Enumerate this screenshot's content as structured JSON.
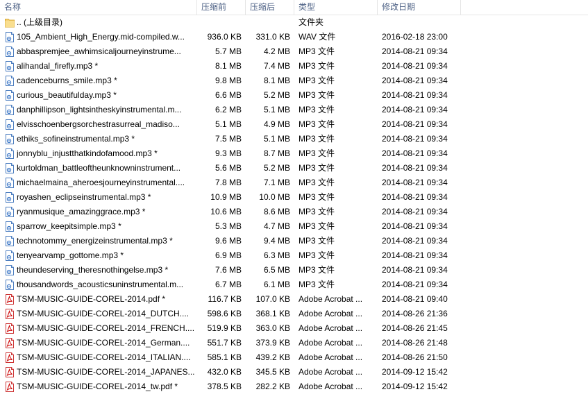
{
  "header": {
    "name": "名称",
    "compressed": "压缩前",
    "size": "压缩后",
    "type": "类型",
    "modified": "修改日期"
  },
  "rows": [
    {
      "icon": "folder-icon",
      "name": ".. (上级目录)",
      "compressed": "",
      "size": "",
      "type": "文件夹",
      "modified": ""
    },
    {
      "icon": "audio-file-icon",
      "name": "105_Ambient_High_Energy.mid-compiled.w...",
      "compressed": "936.0 KB",
      "size": "331.0 KB",
      "type": "WAV 文件",
      "modified": "2016-02-18 23:00"
    },
    {
      "icon": "audio-file-icon",
      "name": "abbaspremjee_awhimsicaljourneyinstrume...",
      "compressed": "5.7 MB",
      "size": "4.2 MB",
      "type": "MP3 文件",
      "modified": "2014-08-21 09:34"
    },
    {
      "icon": "audio-file-icon",
      "name": "alihandal_firefly.mp3 *",
      "compressed": "8.1 MB",
      "size": "7.4 MB",
      "type": "MP3 文件",
      "modified": "2014-08-21 09:34"
    },
    {
      "icon": "audio-file-icon",
      "name": "cadenceburns_smile.mp3 *",
      "compressed": "9.8 MB",
      "size": "8.1 MB",
      "type": "MP3 文件",
      "modified": "2014-08-21 09:34"
    },
    {
      "icon": "audio-file-icon",
      "name": "curious_beautifulday.mp3 *",
      "compressed": "6.6 MB",
      "size": "5.2 MB",
      "type": "MP3 文件",
      "modified": "2014-08-21 09:34"
    },
    {
      "icon": "audio-file-icon",
      "name": "danphillipson_lightsintheskyinstrumental.m...",
      "compressed": "6.2 MB",
      "size": "5.1 MB",
      "type": "MP3 文件",
      "modified": "2014-08-21 09:34"
    },
    {
      "icon": "audio-file-icon",
      "name": "elvisschoenbergsorchestrasurreal_madiso...",
      "compressed": "5.1 MB",
      "size": "4.9 MB",
      "type": "MP3 文件",
      "modified": "2014-08-21 09:34"
    },
    {
      "icon": "audio-file-icon",
      "name": "ethiks_sofineinstrumental.mp3 *",
      "compressed": "7.5 MB",
      "size": "5.1 MB",
      "type": "MP3 文件",
      "modified": "2014-08-21 09:34"
    },
    {
      "icon": "audio-file-icon",
      "name": "jonnyblu_injustthatkindofamood.mp3 *",
      "compressed": "9.3 MB",
      "size": "8.7 MB",
      "type": "MP3 文件",
      "modified": "2014-08-21 09:34"
    },
    {
      "icon": "audio-file-icon",
      "name": "kurtoldman_battleoftheunknowninstrument...",
      "compressed": "5.6 MB",
      "size": "5.2 MB",
      "type": "MP3 文件",
      "modified": "2014-08-21 09:34"
    },
    {
      "icon": "audio-file-icon",
      "name": "michaelmaina_aheroesjourneyinstrumental....",
      "compressed": "7.8 MB",
      "size": "7.1 MB",
      "type": "MP3 文件",
      "modified": "2014-08-21 09:34"
    },
    {
      "icon": "audio-file-icon",
      "name": "royashen_eclipseinstrumental.mp3 *",
      "compressed": "10.9 MB",
      "size": "10.0 MB",
      "type": "MP3 文件",
      "modified": "2014-08-21 09:34"
    },
    {
      "icon": "audio-file-icon",
      "name": "ryanmusique_amazinggrace.mp3 *",
      "compressed": "10.6 MB",
      "size": "8.6 MB",
      "type": "MP3 文件",
      "modified": "2014-08-21 09:34"
    },
    {
      "icon": "audio-file-icon",
      "name": "sparrow_keepitsimple.mp3 *",
      "compressed": "5.3 MB",
      "size": "4.7 MB",
      "type": "MP3 文件",
      "modified": "2014-08-21 09:34"
    },
    {
      "icon": "audio-file-icon",
      "name": "technotommy_energizeinstrumental.mp3 *",
      "compressed": "9.6 MB",
      "size": "9.4 MB",
      "type": "MP3 文件",
      "modified": "2014-08-21 09:34"
    },
    {
      "icon": "audio-file-icon",
      "name": "tenyearvamp_gottome.mp3 *",
      "compressed": "6.9 MB",
      "size": "6.3 MB",
      "type": "MP3 文件",
      "modified": "2014-08-21 09:34"
    },
    {
      "icon": "audio-file-icon",
      "name": "theundeserving_theresnothingelse.mp3 *",
      "compressed": "7.6 MB",
      "size": "6.5 MB",
      "type": "MP3 文件",
      "modified": "2014-08-21 09:34"
    },
    {
      "icon": "audio-file-icon",
      "name": "thousandwords_acousticsuninstrumental.m...",
      "compressed": "6.7 MB",
      "size": "6.1 MB",
      "type": "MP3 文件",
      "modified": "2014-08-21 09:34"
    },
    {
      "icon": "pdf-file-icon",
      "name": "TSM-MUSIC-GUIDE-COREL-2014.pdf *",
      "compressed": "116.7 KB",
      "size": "107.0 KB",
      "type": "Adobe Acrobat ...",
      "modified": "2014-08-21 09:40"
    },
    {
      "icon": "pdf-file-icon",
      "name": "TSM-MUSIC-GUIDE-COREL-2014_DUTCH....",
      "compressed": "598.6 KB",
      "size": "368.1 KB",
      "type": "Adobe Acrobat ...",
      "modified": "2014-08-26 21:36"
    },
    {
      "icon": "pdf-file-icon",
      "name": "TSM-MUSIC-GUIDE-COREL-2014_FRENCH....",
      "compressed": "519.9 KB",
      "size": "363.0 KB",
      "type": "Adobe Acrobat ...",
      "modified": "2014-08-26 21:45"
    },
    {
      "icon": "pdf-file-icon",
      "name": "TSM-MUSIC-GUIDE-COREL-2014_German....",
      "compressed": "551.7 KB",
      "size": "373.9 KB",
      "type": "Adobe Acrobat ...",
      "modified": "2014-08-26 21:48"
    },
    {
      "icon": "pdf-file-icon",
      "name": "TSM-MUSIC-GUIDE-COREL-2014_ITALIAN....",
      "compressed": "585.1 KB",
      "size": "439.2 KB",
      "type": "Adobe Acrobat ...",
      "modified": "2014-08-26 21:50"
    },
    {
      "icon": "pdf-file-icon",
      "name": "TSM-MUSIC-GUIDE-COREL-2014_JAPANES...",
      "compressed": "432.0 KB",
      "size": "345.5 KB",
      "type": "Adobe Acrobat ...",
      "modified": "2014-09-12 15:42"
    },
    {
      "icon": "pdf-file-icon",
      "name": "TSM-MUSIC-GUIDE-COREL-2014_tw.pdf *",
      "compressed": "378.5 KB",
      "size": "282.2 KB",
      "type": "Adobe Acrobat ...",
      "modified": "2014-09-12 15:42"
    }
  ]
}
